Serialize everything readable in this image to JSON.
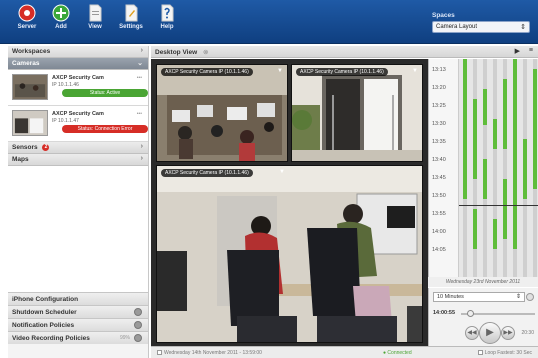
{
  "toolbar": {
    "buttons": [
      {
        "label": "Server"
      },
      {
        "label": "Add"
      },
      {
        "label": "View"
      },
      {
        "label": "Settings"
      },
      {
        "label": "Help"
      }
    ],
    "spaces_label": "Spaces",
    "spaces_value": "Camera Layout"
  },
  "sidebar": {
    "workspaces": "Workspaces",
    "cameras": "Cameras",
    "camera_list": [
      {
        "name": "AXCP Security Cam",
        "ip": "IP 10.1.1.46",
        "status": "Status: Active",
        "status_color": "#4aa534"
      },
      {
        "name": "AXCP Security Cam",
        "ip": "IP 10.1.1.47",
        "status": "Status: Connection Error",
        "status_color": "#d62d26"
      }
    ],
    "sensors": "Sensors",
    "sensors_badge": "2",
    "maps": "Maps",
    "footer": [
      {
        "label": "iPhone Configuration"
      },
      {
        "label": "Shutdown Scheduler"
      },
      {
        "label": "Notification Policies"
      },
      {
        "label": "Video Recording Policies",
        "extra": "99%"
      }
    ]
  },
  "main": {
    "tab": "Desktop View",
    "feeds": [
      {
        "title": "AXCP Security Camera IP (10.1.1.46)"
      },
      {
        "title": "AXCP Security Camera IP (10.1.1.46)"
      },
      {
        "title": "AXCP Security Camera IP (10.1.1.46)"
      }
    ]
  },
  "timeline": {
    "times": [
      "13:13",
      "13:20",
      "13:25",
      "13:30",
      "13:35",
      "13:40",
      "13:45",
      "13:50",
      "13:55",
      "14:00",
      "14:05"
    ],
    "date": "Wednesday 23rd November 2011"
  },
  "controls": {
    "speed": "10 Minutes",
    "time": "14:00:55",
    "right_readout": "20:30"
  },
  "status": {
    "left": "Wednesday 14th November 2011 - 13:59:00",
    "mid": "Connected",
    "right": "Loop Fastest: 30 Sec"
  },
  "colors": {
    "accent": "#1f5aa6",
    "ok": "#4aa534",
    "error": "#d62d26"
  }
}
